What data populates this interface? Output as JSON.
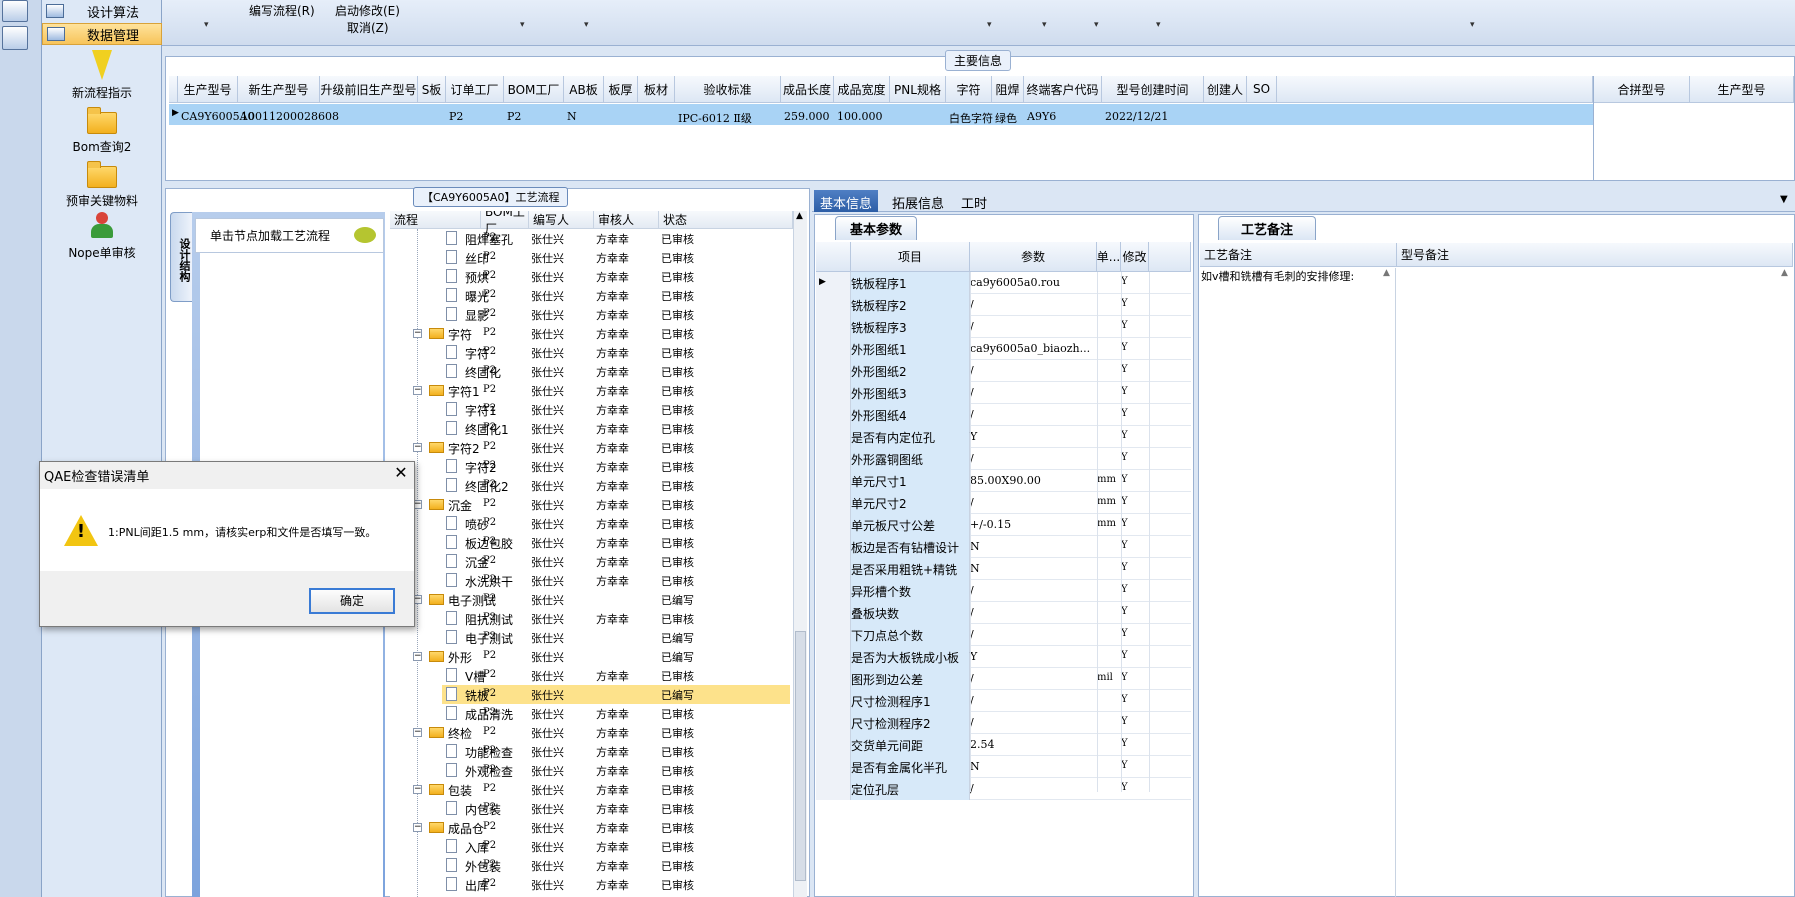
{
  "nav": {
    "top_item": "设计算法",
    "selected_item": "数据管理",
    "items": [
      {
        "label": "新流程指示",
        "icon": "lightning-icon"
      },
      {
        "label": "Bom查询2",
        "icon": "folder-icon"
      },
      {
        "label": "预审关键物料",
        "icon": "folder-icon"
      },
      {
        "label": "Nope单审核",
        "icon": "user-icon"
      }
    ]
  },
  "toolbar": {
    "edit_flow": "编写流程(R)",
    "start_modify": "启动修改(E)",
    "cancel": "取消(Z)"
  },
  "main_info": {
    "label": "主要信息",
    "columns": [
      "生产型号",
      "新生产型号",
      "升级前旧生产型号",
      "S板",
      "订单工厂",
      "BOM工厂",
      "AB板",
      "板厚",
      "板材",
      "验收标准",
      "成品长度",
      "成品宽度",
      "PNL规格",
      "字符",
      "阻焊",
      "终端客户代码",
      "型号创建时间",
      "创建人",
      "SO"
    ],
    "row": [
      "CA9Y6005A0",
      "10011200028608",
      "",
      "",
      "P2",
      "P2",
      "N",
      "",
      "",
      "IPC-6012 Ⅱ级",
      "259.000",
      "100.000",
      "",
      "白色字符",
      "绿色",
      "A9Y6",
      "2022/12/21",
      "",
      ""
    ],
    "merge_columns": [
      "合拼型号",
      "生产型号"
    ]
  },
  "flow": {
    "label": "【CA9Y6005A0】工艺流程",
    "side_tab": "设计结构",
    "hint": "单击节点加载工艺流程",
    "columns": [
      "流程",
      "BOM工厂",
      "编写人",
      "审核人",
      "状态"
    ],
    "rows": [
      {
        "name": "阻焊塞孔",
        "level": 2,
        "bom": "P2",
        "writer": "张仕兴",
        "reviewer": "方幸幸",
        "status": "已审核"
      },
      {
        "name": "丝印",
        "level": 2,
        "bom": "P2",
        "writer": "张仕兴",
        "reviewer": "方幸幸",
        "status": "已审核"
      },
      {
        "name": "预烘",
        "level": 2,
        "bom": "P2",
        "writer": "张仕兴",
        "reviewer": "方幸幸",
        "status": "已审核"
      },
      {
        "name": "曝光",
        "level": 2,
        "bom": "P2",
        "writer": "张仕兴",
        "reviewer": "方幸幸",
        "status": "已审核"
      },
      {
        "name": "显影",
        "level": 2,
        "bom": "P2",
        "writer": "张仕兴",
        "reviewer": "方幸幸",
        "status": "已审核"
      },
      {
        "name": "字符",
        "level": 1,
        "bom": "P2",
        "writer": "张仕兴",
        "reviewer": "方幸幸",
        "status": "已审核"
      },
      {
        "name": "字符",
        "level": 2,
        "bom": "P2",
        "writer": "张仕兴",
        "reviewer": "方幸幸",
        "status": "已审核"
      },
      {
        "name": "终固化",
        "level": 2,
        "bom": "P2",
        "writer": "张仕兴",
        "reviewer": "方幸幸",
        "status": "已审核"
      },
      {
        "name": "字符1",
        "level": 1,
        "bom": "P2",
        "writer": "张仕兴",
        "reviewer": "方幸幸",
        "status": "已审核"
      },
      {
        "name": "字符1",
        "level": 2,
        "bom": "P2",
        "writer": "张仕兴",
        "reviewer": "方幸幸",
        "status": "已审核"
      },
      {
        "name": "终固化1",
        "level": 2,
        "bom": "P2",
        "writer": "张仕兴",
        "reviewer": "方幸幸",
        "status": "已审核"
      },
      {
        "name": "字符2",
        "level": 1,
        "bom": "P2",
        "writer": "张仕兴",
        "reviewer": "方幸幸",
        "status": "已审核"
      },
      {
        "name": "字符2",
        "level": 2,
        "bom": "P2",
        "writer": "张仕兴",
        "reviewer": "方幸幸",
        "status": "已审核"
      },
      {
        "name": "终固化2",
        "level": 2,
        "bom": "P2",
        "writer": "张仕兴",
        "reviewer": "方幸幸",
        "status": "已审核"
      },
      {
        "name": "沉金",
        "level": 1,
        "bom": "P2",
        "writer": "张仕兴",
        "reviewer": "方幸幸",
        "status": "已审核"
      },
      {
        "name": "喷砂",
        "level": 2,
        "bom": "P2",
        "writer": "张仕兴",
        "reviewer": "方幸幸",
        "status": "已审核"
      },
      {
        "name": "板边包胶",
        "level": 2,
        "bom": "P2",
        "writer": "张仕兴",
        "reviewer": "方幸幸",
        "status": "已审核"
      },
      {
        "name": "沉金",
        "level": 2,
        "bom": "P2",
        "writer": "张仕兴",
        "reviewer": "方幸幸",
        "status": "已审核"
      },
      {
        "name": "水洗烘干",
        "level": 2,
        "bom": "P2",
        "writer": "张仕兴",
        "reviewer": "方幸幸",
        "status": "已审核"
      },
      {
        "name": "电子测试",
        "level": 1,
        "bom": "P2",
        "writer": "张仕兴",
        "reviewer": "",
        "status": "已编写"
      },
      {
        "name": "阻抗测试",
        "level": 2,
        "bom": "P2",
        "writer": "张仕兴",
        "reviewer": "方幸幸",
        "status": "已审核"
      },
      {
        "name": "电子测试",
        "level": 2,
        "bom": "P2",
        "writer": "张仕兴",
        "reviewer": "",
        "status": "已编写"
      },
      {
        "name": "外形",
        "level": 1,
        "bom": "P2",
        "writer": "张仕兴",
        "reviewer": "",
        "status": "已编写"
      },
      {
        "name": "V槽",
        "level": 2,
        "bom": "P2",
        "writer": "张仕兴",
        "reviewer": "方幸幸",
        "status": "已审核"
      },
      {
        "name": "铣板",
        "level": 2,
        "bom": "P2",
        "writer": "张仕兴",
        "reviewer": "",
        "status": "已编写",
        "selected": true
      },
      {
        "name": "成品清洗",
        "level": 2,
        "bom": "P2",
        "writer": "张仕兴",
        "reviewer": "方幸幸",
        "status": "已审核"
      },
      {
        "name": "终检",
        "level": 1,
        "bom": "P2",
        "writer": "张仕兴",
        "reviewer": "方幸幸",
        "status": "已审核"
      },
      {
        "name": "功能检查",
        "level": 2,
        "bom": "P2",
        "writer": "张仕兴",
        "reviewer": "方幸幸",
        "status": "已审核"
      },
      {
        "name": "外观检查",
        "level": 2,
        "bom": "P2",
        "writer": "张仕兴",
        "reviewer": "方幸幸",
        "status": "已审核"
      },
      {
        "name": "包装",
        "level": 1,
        "bom": "P2",
        "writer": "张仕兴",
        "reviewer": "方幸幸",
        "status": "已审核"
      },
      {
        "name": "内包装",
        "level": 2,
        "bom": "P2",
        "writer": "张仕兴",
        "reviewer": "方幸幸",
        "status": "已审核"
      },
      {
        "name": "成品仓",
        "level": 1,
        "bom": "P2",
        "writer": "张仕兴",
        "reviewer": "方幸幸",
        "status": "已审核"
      },
      {
        "name": "入库",
        "level": 2,
        "bom": "P2",
        "writer": "张仕兴",
        "reviewer": "方幸幸",
        "status": "已审核"
      },
      {
        "name": "外包装",
        "level": 2,
        "bom": "P2",
        "writer": "张仕兴",
        "reviewer": "方幸幸",
        "status": "已审核"
      },
      {
        "name": "出库",
        "level": 2,
        "bom": "P2",
        "writer": "张仕兴",
        "reviewer": "方幸幸",
        "status": "已审核"
      }
    ]
  },
  "detail_tabs": [
    "基本信息",
    "拓展信息",
    "工时"
  ],
  "params": {
    "tab": "基本参数",
    "columns": [
      "项目",
      "参数",
      "单...",
      "修改"
    ],
    "rows": [
      {
        "k": "铣板程序1",
        "v": "ca9y6005a0.rou",
        "u": "",
        "m": "Y"
      },
      {
        "k": "铣板程序2",
        "v": "/",
        "u": "",
        "m": "Y"
      },
      {
        "k": "铣板程序3",
        "v": "/",
        "u": "",
        "m": "Y"
      },
      {
        "k": "外形图纸1",
        "v": "ca9y6005a0_biaozh...",
        "u": "",
        "m": "Y"
      },
      {
        "k": "外形图纸2",
        "v": "/",
        "u": "",
        "m": "Y"
      },
      {
        "k": "外形图纸3",
        "v": "/",
        "u": "",
        "m": "Y"
      },
      {
        "k": "外形图纸4",
        "v": "/",
        "u": "",
        "m": "Y"
      },
      {
        "k": "是否有内定位孔",
        "v": "Y",
        "u": "",
        "m": "Y"
      },
      {
        "k": "外形露铜图纸",
        "v": "/",
        "u": "",
        "m": "Y"
      },
      {
        "k": "单元尺寸1",
        "v": "85.00X90.00",
        "u": "mm",
        "m": "Y"
      },
      {
        "k": "单元尺寸2",
        "v": "/",
        "u": "mm",
        "m": "Y"
      },
      {
        "k": "单元板尺寸公差",
        "v": "+/-0.15",
        "u": "mm",
        "m": "Y"
      },
      {
        "k": "板边是否有钻槽设计",
        "v": "N",
        "u": "",
        "m": "Y"
      },
      {
        "k": "是否采用粗铣+精铣",
        "v": "N",
        "u": "",
        "m": "Y"
      },
      {
        "k": "异形槽个数",
        "v": "/",
        "u": "",
        "m": "Y"
      },
      {
        "k": "叠板块数",
        "v": "/",
        "u": "",
        "m": "Y"
      },
      {
        "k": "下刀点总个数",
        "v": "/",
        "u": "",
        "m": "Y"
      },
      {
        "k": "是否为大板铣成小板",
        "v": "Y",
        "u": "",
        "m": "Y"
      },
      {
        "k": "图形到边公差",
        "v": "/",
        "u": "mil",
        "m": "Y"
      },
      {
        "k": "尺寸检测程序1",
        "v": "/",
        "u": "",
        "m": "Y"
      },
      {
        "k": "尺寸检测程序2",
        "v": "/",
        "u": "",
        "m": "Y"
      },
      {
        "k": "交货单元间距",
        "v": "2.54",
        "u": "",
        "m": "Y"
      },
      {
        "k": "是否有金属化半孔",
        "v": "N",
        "u": "",
        "m": "Y"
      },
      {
        "k": "定位孔层",
        "v": "/",
        "u": "",
        "m": "Y"
      }
    ]
  },
  "remarks": {
    "tab": "工艺备注",
    "columns": [
      "工艺备注",
      "型号备注"
    ],
    "process_remark": "如v槽和铣槽有毛刺的安排修理:"
  },
  "dialog": {
    "title": "QAE检查错误清单",
    "close": "✕",
    "message": "1:PNL间距1.5 mm，请核实erp和文件是否填写一致。",
    "warning_icon": "!",
    "ok": "确定"
  },
  "colors": {
    "accent": "#2d5ea6",
    "selected_row": "#a9d3f5",
    "tree_selected": "#fde28b",
    "nav_selected": "#f7c45a"
  }
}
